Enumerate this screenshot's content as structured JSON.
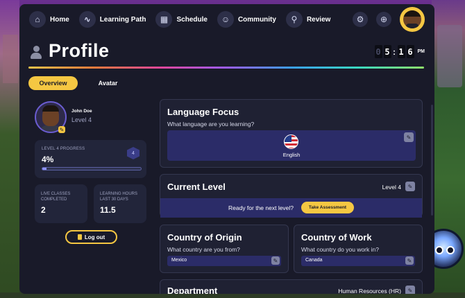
{
  "nav": {
    "items": [
      {
        "label": "Home",
        "icon": "home-icon"
      },
      {
        "label": "Learning Path",
        "icon": "path-icon"
      },
      {
        "label": "Schedule",
        "icon": "calendar-icon"
      },
      {
        "label": "Community",
        "icon": "community-icon"
      },
      {
        "label": "Review",
        "icon": "review-icon"
      }
    ],
    "settings_icon": "gear-icon",
    "help_icon": "lifebuoy-icon"
  },
  "header": {
    "title": "Profile",
    "clock": {
      "digits": [
        "0",
        "5",
        "1",
        "6"
      ],
      "period": "PM"
    }
  },
  "tabs": [
    {
      "label": "Overview",
      "active": true
    },
    {
      "label": "Avatar",
      "active": false
    }
  ],
  "user": {
    "name": "John Doe",
    "level": "Level 4"
  },
  "progress": {
    "label": "LEVEL 4 PROGRESS",
    "value": "4%",
    "badge": "4",
    "percent": 4
  },
  "stats": [
    {
      "label_line1": "LIVE CLASSES",
      "label_line2": "COMPLETED",
      "value": "2"
    },
    {
      "label_line1": "LEARNING HOURS",
      "label_line2": "LAST 30 DAYS",
      "value": "11.5"
    }
  ],
  "logout_label": "Log out",
  "language_focus": {
    "title": "Language Focus",
    "subtitle": "What language are you learning?",
    "language": "English"
  },
  "current_level": {
    "title": "Current Level",
    "value": "Level 4",
    "prompt": "Ready for the next level?",
    "button": "Take Assessment"
  },
  "origin": {
    "title": "Country of Origin",
    "subtitle": "What country are you from?",
    "value": "Mexico"
  },
  "work": {
    "title": "Country of Work",
    "subtitle": "What country do you work in?",
    "value": "Canada"
  },
  "department": {
    "title": "Department",
    "value": "Human Resources (HR)"
  },
  "colors": {
    "accent": "#f5c742",
    "panel": "#191a29",
    "card": "#1f2133",
    "highlight": "#2b2c68"
  }
}
